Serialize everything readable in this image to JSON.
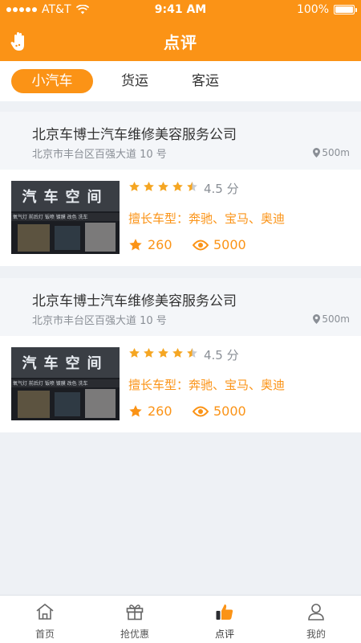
{
  "status_bar": {
    "carrier": "AT&T",
    "time": "9:41 AM",
    "battery": "100%",
    "battery_level": 1.0
  },
  "header": {
    "title": "点评"
  },
  "tabs": [
    {
      "label": "小汽车",
      "active": true
    },
    {
      "label": "货运",
      "active": false
    },
    {
      "label": "客运",
      "active": false
    }
  ],
  "shops": [
    {
      "name": "北京车博士汽车维修美容服务公司",
      "address": "北京市丰台区百强大道 10 号",
      "distance": "500m",
      "image_sign": "汽车空间",
      "image_strip": "氧气灯 前后灯 钣喷 镀膜 改色 洗车",
      "rating": 4.5,
      "score": "4.5 分",
      "models": "擅长车型：奔驰、宝马、奥迪",
      "favorites": "260",
      "views": "5000"
    },
    {
      "name": "北京车博士汽车维修美容服务公司",
      "address": "北京市丰台区百强大道 10 号",
      "distance": "500m",
      "image_sign": "汽车空间",
      "image_strip": "氧气灯 前后灯 钣喷 镀膜 改色 洗车",
      "rating": 4.5,
      "score": "4.5 分",
      "models": "擅长车型：奔驰、宝马、奥迪",
      "favorites": "260",
      "views": "5000"
    }
  ],
  "tabbar": [
    {
      "label": "首页",
      "icon": "home-icon",
      "active": false
    },
    {
      "label": "抢优惠",
      "icon": "gift-icon",
      "active": false
    },
    {
      "label": "点评",
      "icon": "thumbs-up-icon",
      "active": true
    },
    {
      "label": "我的",
      "icon": "user-icon",
      "active": false
    }
  ],
  "colors": {
    "accent": "#fb9316",
    "star_filled": "#f5a623",
    "star_empty": "#c9ccd1",
    "icon_gray": "#666666"
  }
}
